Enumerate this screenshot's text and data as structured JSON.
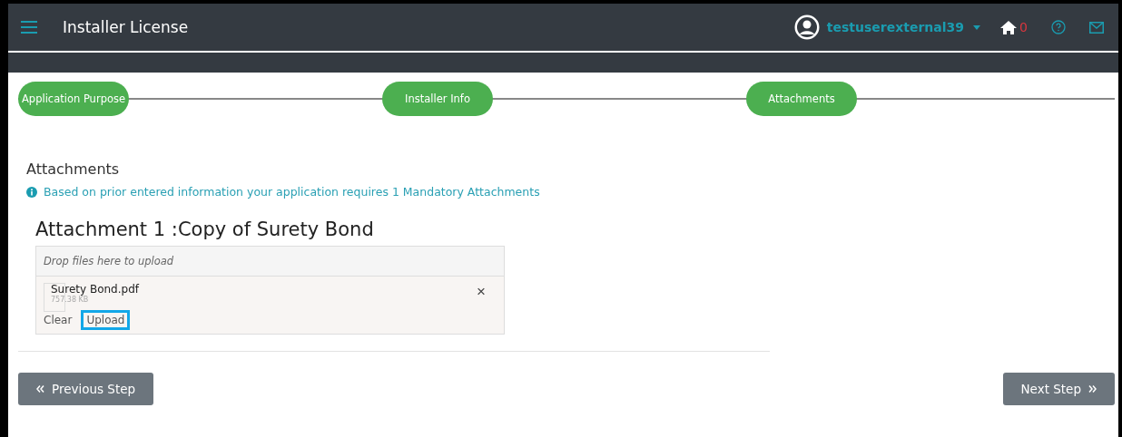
{
  "header": {
    "title": "Installer License",
    "username": "testuserexternal39",
    "home_count": "0"
  },
  "steps": [
    {
      "label": "Application Purpose"
    },
    {
      "label": "Installer Info"
    },
    {
      "label": "Attachments"
    }
  ],
  "section": {
    "title": "Attachments",
    "info": "Based on prior entered information your application requires 1 Mandatory Attachments"
  },
  "attachments": [
    {
      "title": "Attachment 1 :Copy of Surety Bond",
      "drop_hint": "Drop files here to upload",
      "files": [
        {
          "name": "Surety Bond.pdf",
          "size": "757.38 KB",
          "remove": "×"
        }
      ],
      "clear": "Clear",
      "upload": "Upload",
      "upload_focused": true
    }
  ],
  "footer": {
    "previous": "Previous Step",
    "next": "Next Step"
  }
}
